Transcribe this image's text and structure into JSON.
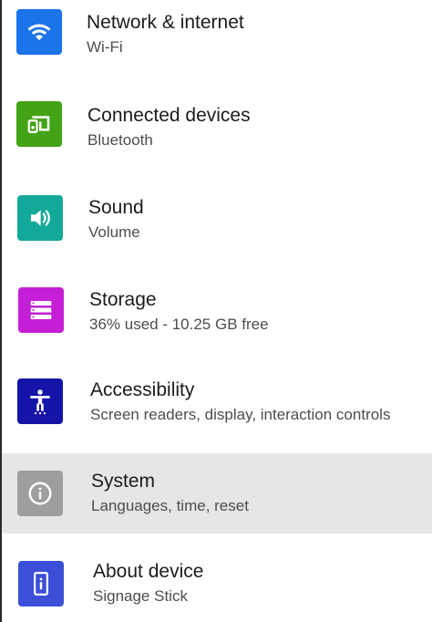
{
  "settings": {
    "items": [
      {
        "title": "Network & internet",
        "subtitle": "Wi-Fi",
        "icon": "wifi-icon",
        "color": "#1a73e8"
      },
      {
        "title": "Connected devices",
        "subtitle": "Bluetooth",
        "icon": "connected-devices-icon",
        "color": "#43a316"
      },
      {
        "title": "Sound",
        "subtitle": "Volume",
        "icon": "speaker-icon",
        "color": "#13a99a"
      },
      {
        "title": "Storage",
        "subtitle": "36% used - 10.25 GB free",
        "icon": "storage-icon",
        "color": "#c41fd6"
      },
      {
        "title": "Accessibility",
        "subtitle": "Screen readers, display, interaction controls",
        "icon": "accessibility-icon",
        "color": "#1414a8"
      },
      {
        "title": "System",
        "subtitle": "Languages, time, reset",
        "icon": "info-icon",
        "color": "#9e9e9e",
        "selected": true
      },
      {
        "title": "About device",
        "subtitle": "Signage Stick",
        "icon": "device-icon",
        "color": "#3b4fd8"
      }
    ]
  },
  "colors": {
    "selected_row_background": "#e6e6e6",
    "title_text": "#1c1c1c",
    "subtitle_text": "#4d4d4d"
  }
}
